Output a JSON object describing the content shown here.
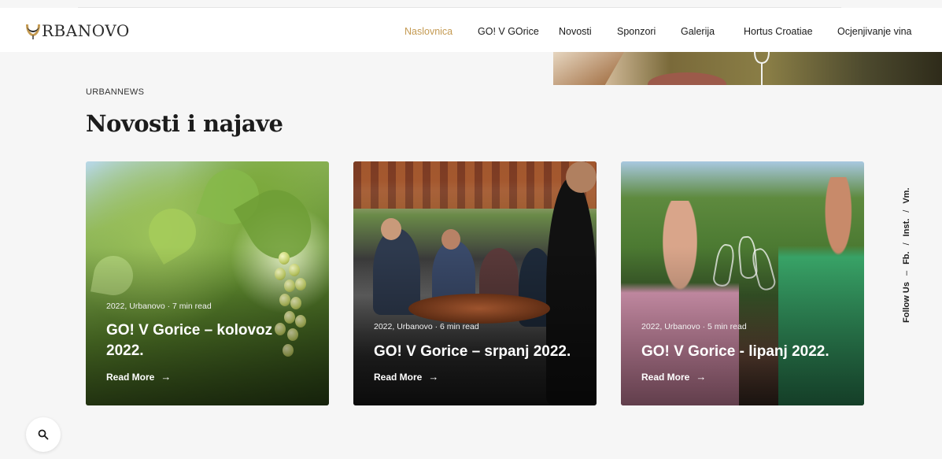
{
  "header": {
    "logo_text": "RBANOVO",
    "nav": [
      {
        "label": "Naslovnica",
        "active": true
      },
      {
        "label": "GO! V GOrice",
        "active": false
      },
      {
        "label": "Novosti",
        "active": false
      },
      {
        "label": "Sponzori",
        "active": false
      },
      {
        "label": "Galerija",
        "active": false
      },
      {
        "label": "Hortus Croatiae",
        "active": false
      },
      {
        "label": "Ocjenjivanje vina",
        "active": false
      }
    ]
  },
  "section": {
    "eyebrow": "URBANNEWS",
    "title": "Novosti i najave"
  },
  "cards": [
    {
      "meta": "2022, Urbanovo · 7 min read",
      "title": "GO! V Gorice – kolovoz 2022.",
      "more": "Read More",
      "image": "grapes-vineyard"
    },
    {
      "meta": "2022, Urbanovo · 6 min read",
      "title": "GO! V Gorice – srpanj 2022.",
      "more": "Read More",
      "image": "outdoor-dining-group"
    },
    {
      "meta": "2022, Urbanovo · 5 min read",
      "title": "GO! V Gorice - lipanj 2022.",
      "more": "Read More",
      "image": "women-toasting-wine"
    }
  ],
  "social": {
    "prefix": "Follow Us",
    "dash": "–",
    "links": [
      "Fb.",
      "Inst.",
      "Vm."
    ],
    "separator": "/"
  },
  "search": {
    "icon": "search-icon"
  },
  "colors": {
    "accent": "#c49a52",
    "background": "#f6f6f6"
  }
}
